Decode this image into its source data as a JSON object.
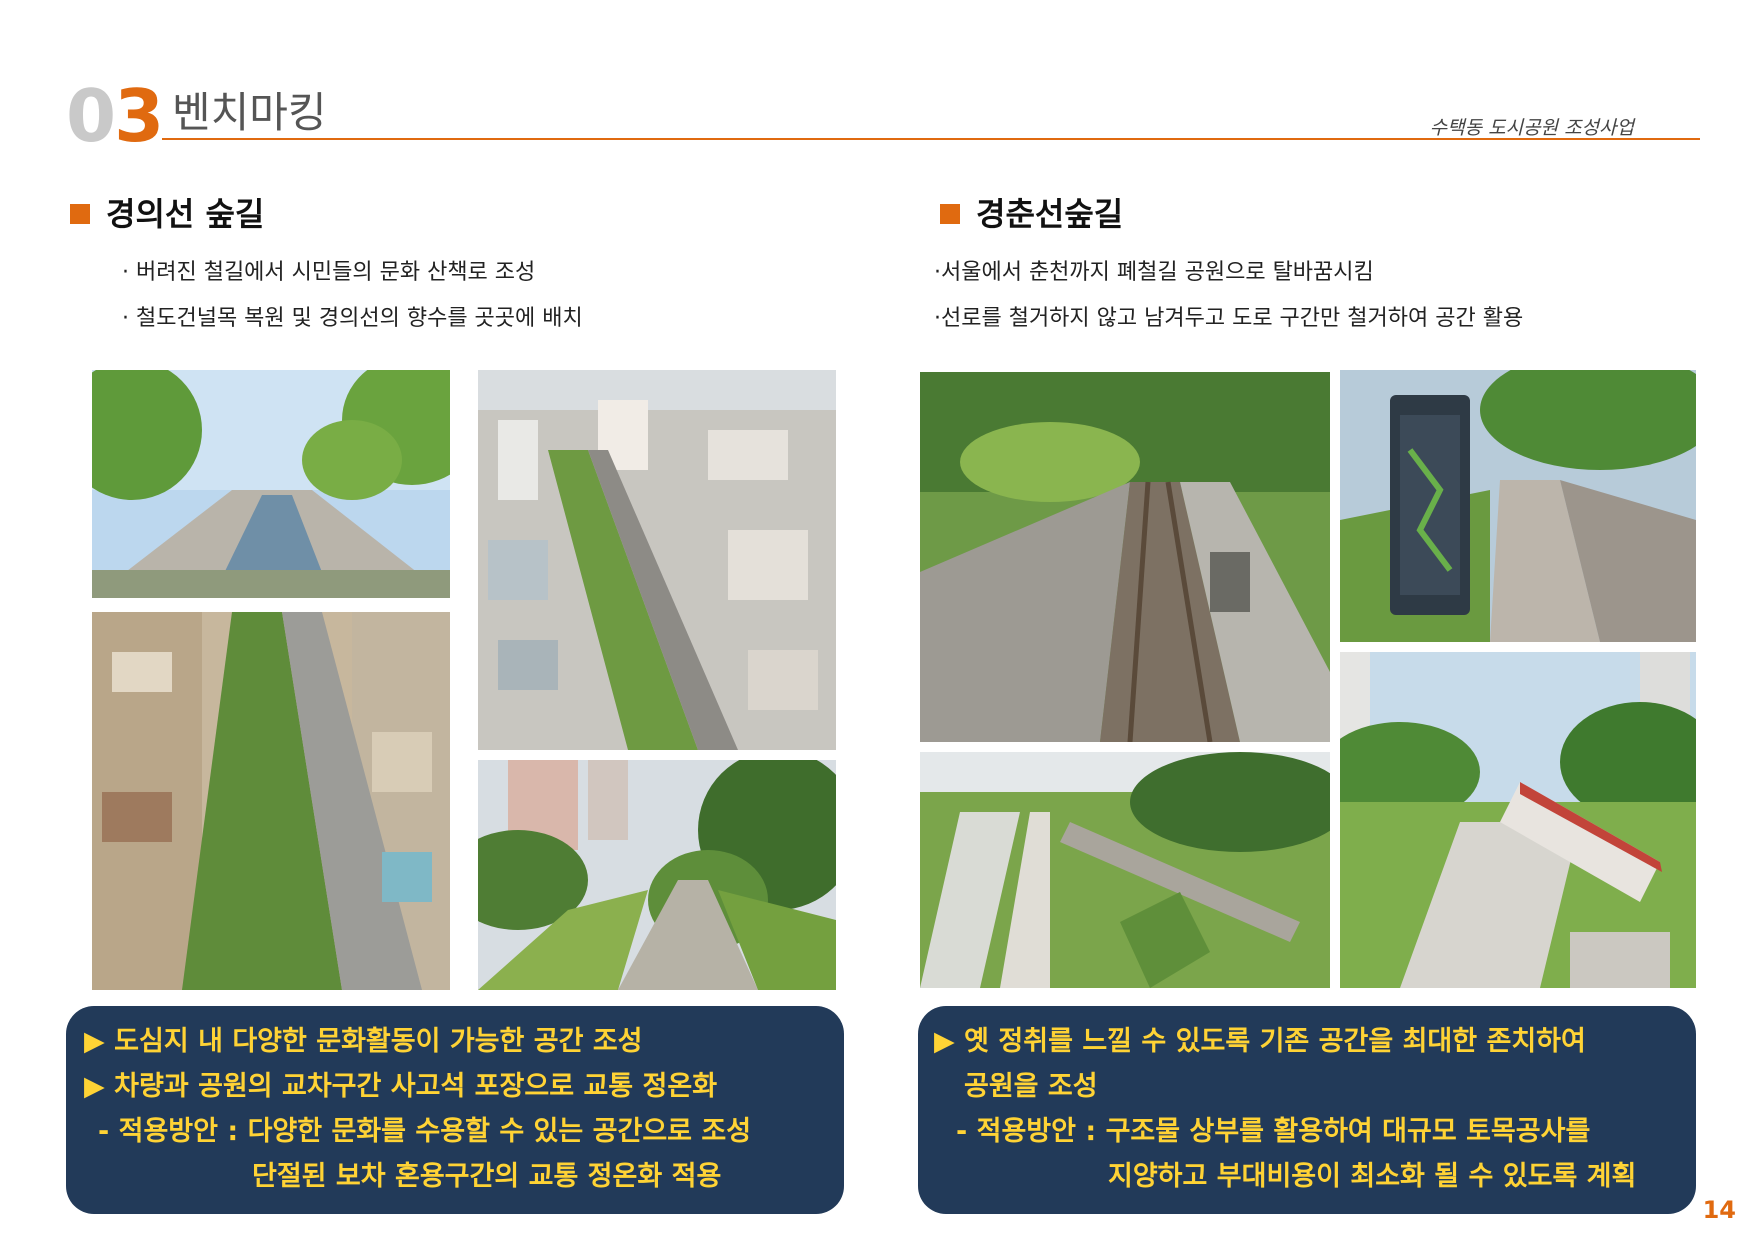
{
  "header": {
    "section_number_dim": "0",
    "section_number_accent": "3",
    "section_title": "벤치마킹",
    "project_name": "수택동 도시공원 조성사업"
  },
  "left": {
    "title": "경의선 숲길",
    "bullets": [
      "· 버려진 철길에서 시민들의 문화 산책로 조성",
      "· 철도건널목 복원 및 경의선의 향수를 곳곳에 배치"
    ],
    "summary": [
      "▶ 도심지 내 다양한 문화활동이 가능한 공간 조성",
      "▶ 차량과 공원의 교차구간 사고석 포장으로 교통 정온화",
      "- 적용방안 : 다양한 문화를 수용할 수 있는 공간으로 조성",
      "단절된 보차 혼용구간의 교통 정온화 적용"
    ]
  },
  "right": {
    "title": "경춘선숲길",
    "bullets": [
      "·서울에서 춘천까지 폐철길 공원으로 탈바꿈시킴",
      "·선로를 철거하지 않고 남겨두고 도로 구간만 철거하여 공간 활용"
    ],
    "summary": [
      "▶ 옛 정취를 느낄 수 있도록 기존 공간을 최대한 존치하여",
      "공원을 조성",
      "- 적용방안 : 구조물 상부를 활용하여 대규모 토목공사를",
      "지양하고 부대비용이 최소화 될 수 있도록 계획"
    ]
  },
  "page_number": "14",
  "colors": {
    "accent": "#e06a10",
    "summary_bg": "#223a59",
    "summary_text": "#ffd335"
  }
}
